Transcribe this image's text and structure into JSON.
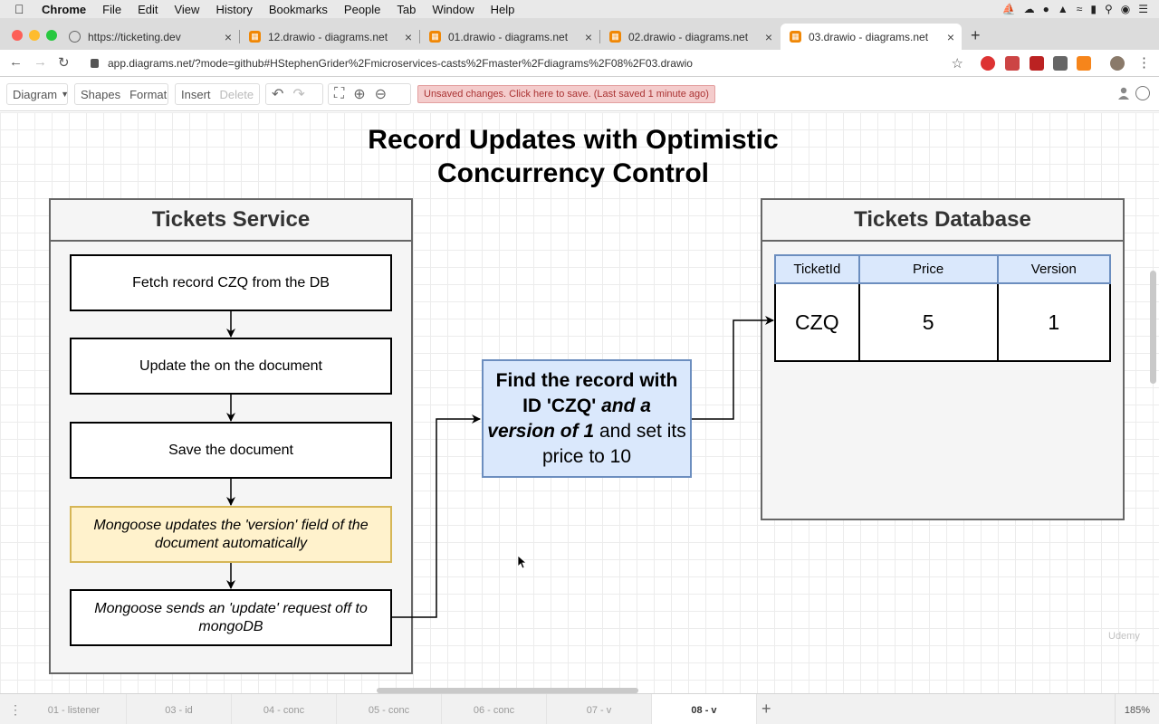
{
  "menubar": {
    "app": "Chrome",
    "items": [
      "File",
      "Edit",
      "View",
      "History",
      "Bookmarks",
      "People",
      "Tab",
      "Window",
      "Help"
    ]
  },
  "tabs": [
    {
      "title": "https://ticketing.dev",
      "icon": "globe-icon"
    },
    {
      "title": "12.drawio - diagrams.net",
      "icon": "drawio-icon"
    },
    {
      "title": "01.drawio - diagrams.net",
      "icon": "drawio-icon"
    },
    {
      "title": "02.drawio - diagrams.net",
      "icon": "drawio-icon"
    },
    {
      "title": "03.drawio - diagrams.net",
      "icon": "drawio-icon",
      "active": true
    }
  ],
  "address": {
    "url": "app.diagrams.net/?mode=github#HStephenGrider%2Fmicroservices-casts%2Fmaster%2Fdiagrams%2F08%2F03.drawio"
  },
  "toolbar": {
    "diagram": "Diagram",
    "shapes": "Shapes",
    "format": "Format",
    "insert": "Insert",
    "delete": "Delete",
    "unsaved": "Unsaved changes. Click here to save. (Last saved 1 minute ago)"
  },
  "diagram": {
    "title_line1": "Record Updates with Optimistic",
    "title_line2": "Concurrency Control",
    "service": {
      "title": "Tickets Service",
      "steps": [
        "Fetch record CZQ from the DB",
        "Update the on the document",
        "Save the document",
        "Mongoose updates the 'version' field of the document automatically",
        "Mongoose sends an 'update' request off to mongoDB"
      ]
    },
    "query": {
      "part1": "Find the record with ID 'CZQ'",
      "part2": "and a version of 1",
      "part3": "and set its price to 10"
    },
    "database": {
      "title": "Tickets Database",
      "columns": [
        "TicketId",
        "Price",
        "Version"
      ],
      "row": [
        "CZQ",
        "5",
        "1"
      ]
    }
  },
  "watermark": "Udemy",
  "pages": {
    "tabs": [
      "01 - listener",
      "03 - id",
      "04 - conc",
      "05 - conc",
      "06 - conc",
      "07 - v",
      "08 - v"
    ],
    "active_index": 6,
    "zoom": "185%"
  },
  "colors": {
    "yellow_fill": "#fff2cc",
    "blue_fill": "#dae8fc",
    "unsaved_bg": "#f4cccc"
  }
}
